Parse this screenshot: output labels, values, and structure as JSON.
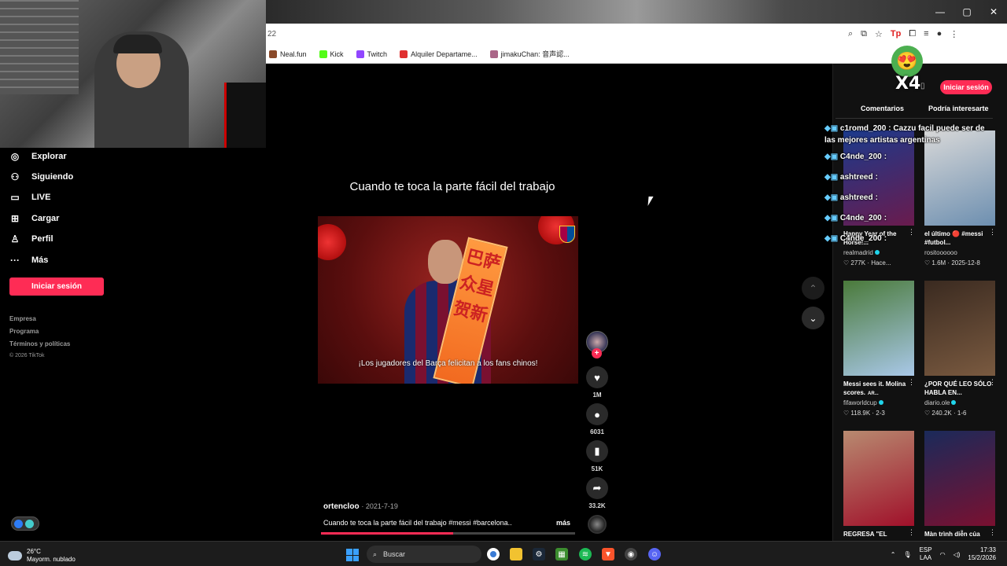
{
  "browser": {
    "url_fragment": "22",
    "window_controls": [
      "—",
      "▢",
      "✕"
    ],
    "bookmarks": [
      {
        "label": "Neal.fun",
        "color": "#8a4a2a"
      },
      {
        "label": "Kick",
        "color": "#53fc18"
      },
      {
        "label": "Twitch",
        "color": "#9146ff"
      },
      {
        "label": "Alquiler Departame...",
        "color": "#e03030"
      },
      {
        "label": "jimakuChan: 音声認...",
        "color": "#aa6688"
      }
    ]
  },
  "sidebar": {
    "items": [
      {
        "label": "Explorar",
        "icon": "compass-icon",
        "glyph": "◎"
      },
      {
        "label": "Siguiendo",
        "icon": "following-icon",
        "glyph": "⚇"
      },
      {
        "label": "LIVE",
        "icon": "live-icon",
        "glyph": "▭"
      },
      {
        "label": "Cargar",
        "icon": "upload-icon",
        "glyph": "⊞"
      },
      {
        "label": "Perfil",
        "icon": "profile-icon",
        "glyph": "♙"
      },
      {
        "label": "Más",
        "icon": "more-icon",
        "glyph": "···"
      }
    ],
    "login_label": "Iniciar sesión",
    "footer": [
      "Empresa",
      "Programa",
      "Términos y políticas"
    ],
    "copyright": "© 2026 TikTok"
  },
  "video": {
    "title": "Cuando te toca la parte fácil del trabajo",
    "caption": "¡Los jugadores del Barça felicitan a los fans chinos!",
    "banner_text": "巴萨众星贺新",
    "author": "ortencloo",
    "date": "2021-7-19",
    "description": "Cuando te toca la parte fácil del trabajo #messi #barcelona...",
    "more_label": "más",
    "progress_percent": 52
  },
  "actions": {
    "likes": "1M",
    "comments": "6031",
    "saves": "51K",
    "shares": "33.2K"
  },
  "right_panel": {
    "login_label": "Iniciar sesión",
    "emote_multiplier": "X4",
    "tabs": [
      "Comentarios",
      "Podría interesarte"
    ],
    "cards": [
      {
        "title": "Happy Year of the Horse!...",
        "author": "realmadrid",
        "verified": true,
        "views": "277K",
        "date": "Hace...",
        "colors": [
          "#1b3a8c",
          "#6a1b4d"
        ]
      },
      {
        "title": "el último 🔴 #messi #futbol...",
        "author": "rositoooooo",
        "verified": false,
        "views": "1.6M",
        "date": "2025-12-8",
        "colors": [
          "#d8d8d8",
          "#6d8fb0"
        ]
      },
      {
        "title": "Messi sees it. Molina scores.",
        "badge": "AR...",
        "author": "fifaworldcup",
        "verified": true,
        "views": "118.9K",
        "date": "2-3",
        "colors": [
          "#4a7a3a",
          "#a9c8e8"
        ]
      },
      {
        "title": "¿POR QUÉ LEO SÓLO HABLA EN...",
        "author": "diario.ole",
        "verified": true,
        "views": "240.2K",
        "date": "1-6",
        "colors": [
          "#3a2a20",
          "#7a5a40"
        ]
      },
      {
        "title": "REGRESA \"EL",
        "author": "",
        "verified": false,
        "views": "",
        "date": "",
        "colors": [
          "#b88a70",
          "#a0102a"
        ]
      },
      {
        "title": "Màn trình diễn của",
        "author": "",
        "verified": false,
        "views": "",
        "date": "",
        "colors": [
          "#1a2a5a",
          "#7a1030"
        ]
      }
    ]
  },
  "chat": [
    {
      "user": "c1romd_200",
      "color": "green",
      "message": ": Cazzu facil puede ser de las mejores artistas argentinas"
    },
    {
      "user": "C4nde_200",
      "color": "purple",
      "message": ":"
    },
    {
      "user": "ashtreed",
      "color": "purple",
      "message": ":"
    },
    {
      "user": "ashtreed",
      "color": "purple",
      "message": ":"
    },
    {
      "user": "C4nde_200",
      "color": "purple",
      "message": ":"
    },
    {
      "user": "C4nde_200",
      "color": "purple",
      "message": ":"
    }
  ],
  "taskbar": {
    "temperature": "26°C",
    "weather": "Mayorm. nublado",
    "search_label": "Buscar",
    "lang_top": "ESP",
    "lang_bottom": "LAA",
    "time": "17:33",
    "date": "15/2/2026"
  },
  "colors": {
    "accent": "#fe2c55",
    "background": "#000000",
    "panel": "#111111"
  }
}
